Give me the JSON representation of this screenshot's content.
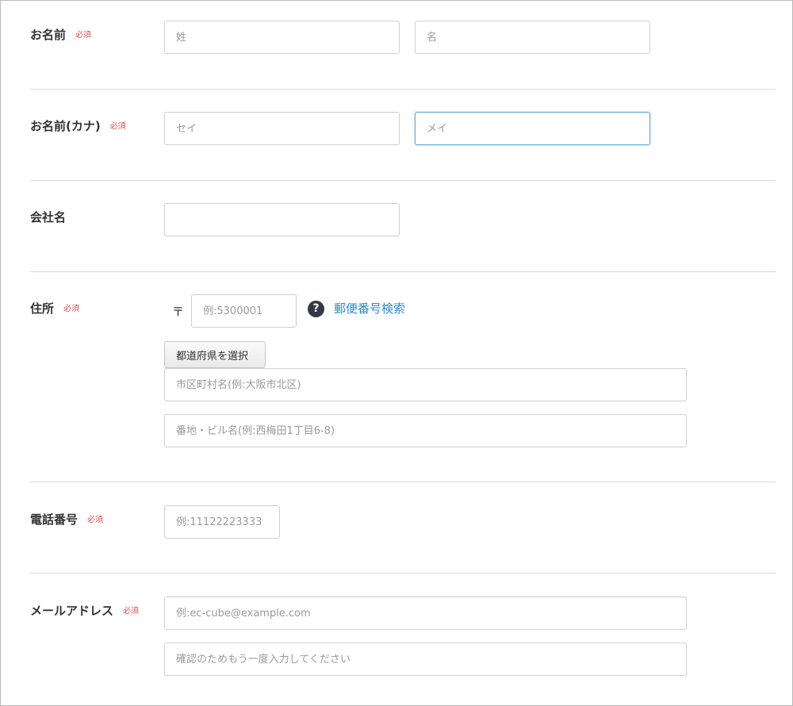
{
  "required_label": "必須",
  "name": {
    "label": "お名前",
    "last_placeholder": "姓",
    "first_placeholder": "名"
  },
  "kana": {
    "label": "お名前(カナ)",
    "last_placeholder": "セイ",
    "first_placeholder": "メイ"
  },
  "company": {
    "label": "会社名",
    "placeholder": ""
  },
  "address": {
    "label": "住所",
    "zip_mark": "〒",
    "zip_placeholder": "例:5300001",
    "help_icon": "?",
    "zip_search_link": "郵便番号検索",
    "pref_button": "都道府県を選択",
    "city_placeholder": "市区町村名(例:大阪市北区)",
    "street_placeholder": "番地・ビル名(例:西梅田1丁目6-8)"
  },
  "phone": {
    "label": "電話番号",
    "placeholder": "例:11122223333"
  },
  "email": {
    "label": "メールアドレス",
    "placeholder": "例:ec-cube@example.com",
    "confirm_placeholder": "確認のためもう一度入力してください"
  },
  "colors": {
    "required": "#d9534f",
    "link": "#2a8cc9",
    "focus_border": "#66a7d6"
  }
}
